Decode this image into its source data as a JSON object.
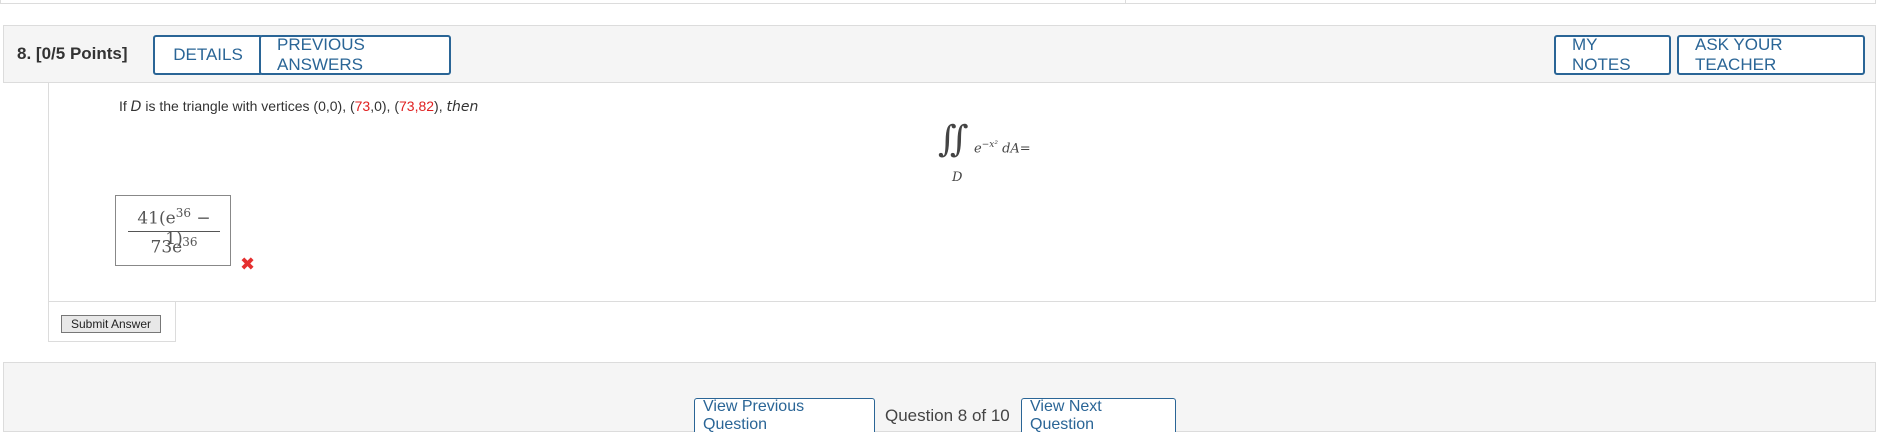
{
  "question": {
    "number_label": "8.",
    "points_label": "[0/5 Points]"
  },
  "header_buttons": {
    "details": "DETAILS",
    "previous_answers": "PREVIOUS ANSWERS",
    "my_notes": "MY NOTES",
    "ask_teacher": "ASK YOUR TEACHER"
  },
  "prompt": {
    "lead": "If ",
    "var_d": "D",
    "mid": " is the triangle with vertices (0,0), (",
    "v1": "73",
    "mid2": ",0), (",
    "v2": "73,82",
    "tail": "), ",
    "then": "then"
  },
  "integral": {
    "symbol": "∬",
    "integrand": "e",
    "exponent": "−x²",
    "diff": " dA=",
    "region": "D"
  },
  "answer": {
    "numerator_coef": "41(e",
    "numerator_exp": "36",
    "numerator_tail": " − 1)",
    "denominator_coef": "73e",
    "denominator_exp": "36",
    "status_icon": "x-mark-icon",
    "status_color": "#e53030"
  },
  "submit": {
    "label": "Submit Answer"
  },
  "navigation": {
    "prev_label": "View Previous Question",
    "count_label": "Question 8 of 10",
    "next_label": "View Next Question"
  },
  "colors": {
    "accent": "#2a6596",
    "highlight": "#e02020"
  }
}
